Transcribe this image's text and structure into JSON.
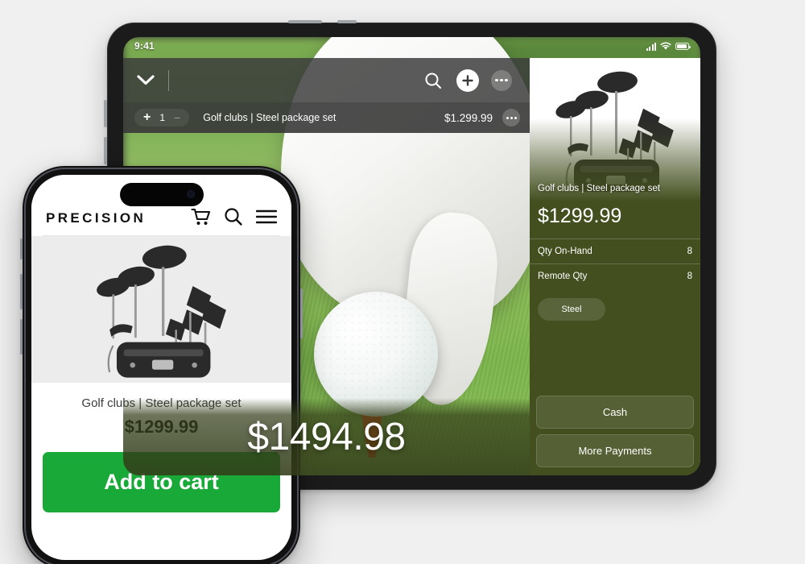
{
  "tablet": {
    "status": {
      "time": "9:41",
      "signal_icon": "cellular-signal-icon",
      "wifi_icon": "wifi-icon",
      "battery_icon": "battery-icon"
    },
    "toolbar": {
      "chevron_icon": "chevron-down-icon",
      "search_icon": "search-icon",
      "add_icon": "plus-circle-icon",
      "more_icon": "more-options-icon"
    },
    "cart_line": {
      "plus": "+",
      "qty": "1",
      "minus": "−",
      "name": "Golf clubs | Steel package set",
      "price": "$1.299.99",
      "more_icon": "more-options-icon"
    },
    "total": {
      "amount": "$1494.98"
    },
    "panel": {
      "product_name": "Golf clubs | Steel package set",
      "price": "$1299.99",
      "rows": [
        {
          "label": "Qty On-Hand",
          "value": "8"
        },
        {
          "label": "Remote Qty",
          "value": "8"
        }
      ],
      "chip": "Steel",
      "buttons": [
        {
          "label": "Cash"
        },
        {
          "label": "More Payments"
        }
      ]
    }
  },
  "phone": {
    "logo": "PRECISION",
    "icons": {
      "cart": "shopping-cart-icon",
      "search": "search-icon",
      "menu": "hamburger-menu-icon"
    },
    "product": {
      "name": "Golf clubs | Steel package set",
      "price": "$1299.99",
      "add_to_cart": "Add to cart"
    }
  },
  "colors": {
    "panel_olive": "#434f1f",
    "add_to_cart_green": "#18a939",
    "toolbar_dark": "#3c3c3c",
    "page_background": "#f0f0f0"
  }
}
